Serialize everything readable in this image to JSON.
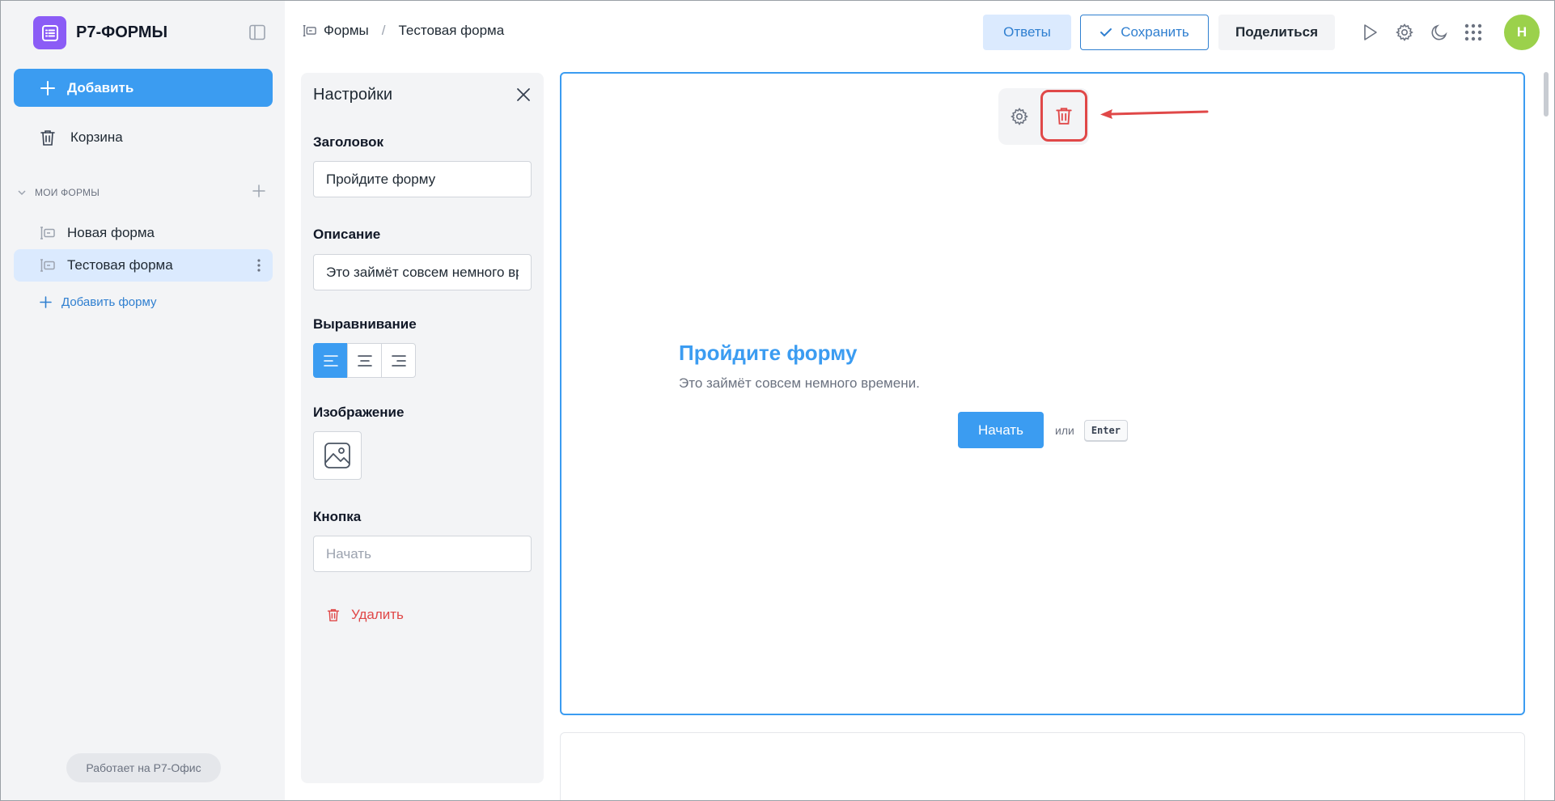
{
  "brand": {
    "name": "Р7-ФОРМЫ"
  },
  "sidebar": {
    "add_label": "Добавить",
    "trash_label": "Корзина",
    "section_title": "МОИ ФОРМЫ",
    "forms": [
      {
        "label": "Новая форма",
        "active": false
      },
      {
        "label": "Тестовая форма",
        "active": true
      }
    ],
    "add_form_label": "Добавить форму",
    "powered_by": "Работает на Р7-Офис"
  },
  "header": {
    "breadcrumb": {
      "root": "Формы",
      "separator": "/",
      "current": "Тестовая форма"
    },
    "answers_label": "Ответы",
    "save_label": "Сохранить",
    "share_label": "Поделиться",
    "avatar_initial": "Н"
  },
  "settings": {
    "title": "Настройки",
    "heading_label": "Заголовок",
    "heading_value": "Пройдите форму",
    "description_label": "Описание",
    "description_value": "Это займёт совсем немного времени.",
    "alignment_label": "Выравнивание",
    "alignment_selected": "left",
    "image_label": "Изображение",
    "button_label": "Кнопка",
    "button_placeholder": "Начать",
    "delete_label": "Удалить"
  },
  "canvas": {
    "title": "Пройдите форму",
    "description": "Это займёт совсем немного времени.",
    "start_label": "Начать",
    "or_label": "или",
    "key_hint": "Enter"
  },
  "colors": {
    "accent": "#3b9cf1",
    "brand": "#8b5cf6",
    "danger": "#e04848",
    "avatar": "#9bd14b"
  }
}
